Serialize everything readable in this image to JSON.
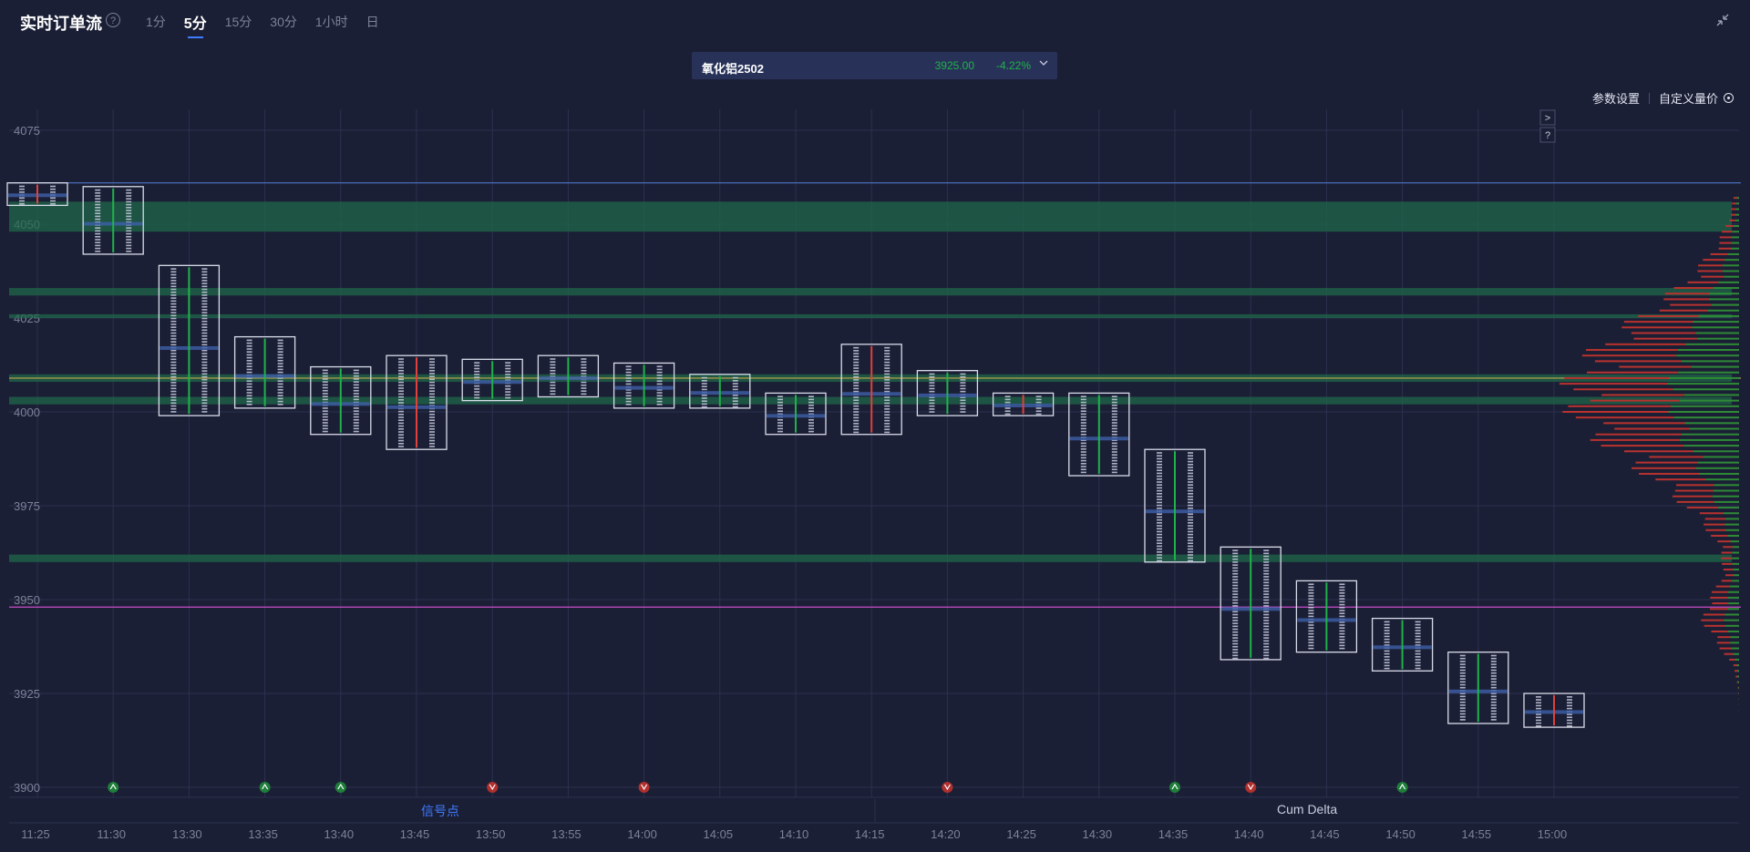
{
  "header": {
    "title": "实时订单流",
    "tabs": [
      {
        "label": "1分",
        "active": false
      },
      {
        "label": "5分",
        "active": true
      },
      {
        "label": "15分",
        "active": false
      },
      {
        "label": "30分",
        "active": false
      },
      {
        "label": "1小时",
        "active": false
      },
      {
        "label": "日",
        "active": false
      }
    ]
  },
  "symbol": {
    "name": "氧化铝2502",
    "price": "3925.00",
    "change": "-4.22%"
  },
  "toolbar": {
    "settings_label": "参数设置",
    "custom_label": "自定义量价"
  },
  "footer": {
    "signal_label": "信号点",
    "cum_delta_label": "Cum Delta"
  },
  "colors": {
    "bg": "#1b1f35",
    "up": "#20b24a",
    "down": "#e0413a",
    "accent": "#3d7bff",
    "box": "#d9dcea"
  },
  "chart_data": {
    "type": "footprint",
    "ylim": [
      3895,
      4080
    ],
    "yticks": [
      4075,
      4050,
      4025,
      4000,
      3975,
      3950,
      3925,
      3900
    ],
    "categories": [
      "11:25",
      "11:30",
      "13:30",
      "13:35",
      "13:40",
      "13:45",
      "13:50",
      "13:55",
      "14:00",
      "14:05",
      "14:10",
      "14:15",
      "14:20",
      "14:25",
      "14:30",
      "14:35",
      "14:40",
      "14:45",
      "14:50",
      "14:55",
      "15:00"
    ],
    "bars": [
      {
        "time": "11:25",
        "high": 4061,
        "low": 4055,
        "delta": "down"
      },
      {
        "time": "11:30",
        "high": 4060,
        "low": 4042,
        "delta": "up"
      },
      {
        "time": "13:30",
        "high": 4039,
        "low": 3999,
        "delta": "up"
      },
      {
        "time": "13:35",
        "high": 4020,
        "low": 4001,
        "delta": "up"
      },
      {
        "time": "13:40",
        "high": 4012,
        "low": 3994,
        "delta": "up"
      },
      {
        "time": "13:45",
        "high": 4015,
        "low": 3990,
        "delta": "down"
      },
      {
        "time": "13:50",
        "high": 4014,
        "low": 4003,
        "delta": "up"
      },
      {
        "time": "13:55",
        "high": 4015,
        "low": 4004,
        "delta": "up"
      },
      {
        "time": "14:00",
        "high": 4013,
        "low": 4001,
        "delta": "up"
      },
      {
        "time": "14:05",
        "high": 4010,
        "low": 4001,
        "delta": "up"
      },
      {
        "time": "14:10",
        "high": 4005,
        "low": 3994,
        "delta": "up"
      },
      {
        "time": "14:15",
        "high": 4018,
        "low": 3994,
        "delta": "down"
      },
      {
        "time": "14:20",
        "high": 4011,
        "low": 3999,
        "delta": "up"
      },
      {
        "time": "14:25",
        "high": 4005,
        "low": 3999,
        "delta": "down"
      },
      {
        "time": "14:30",
        "high": 4005,
        "low": 3983,
        "delta": "up"
      },
      {
        "time": "14:35",
        "high": 3990,
        "low": 3960,
        "delta": "up"
      },
      {
        "time": "14:40",
        "high": 3964,
        "low": 3934,
        "delta": "up"
      },
      {
        "time": "14:45",
        "high": 3955,
        "low": 3936,
        "delta": "up"
      },
      {
        "time": "14:50",
        "high": 3945,
        "low": 3931,
        "delta": "up"
      },
      {
        "time": "14:55",
        "high": 3936,
        "low": 3917,
        "delta": "up"
      },
      {
        "time": "15:00",
        "high": 3925,
        "low": 3916,
        "delta": "down"
      }
    ],
    "bands": [
      {
        "from": 4048,
        "to": 4056
      },
      {
        "from": 4031,
        "to": 4033
      },
      {
        "from": 4025,
        "to": 4026
      },
      {
        "from": 4008,
        "to": 4010
      },
      {
        "from": 4002,
        "to": 4004
      },
      {
        "from": 3960,
        "to": 3962
      }
    ],
    "hlines": [
      {
        "value": 4061,
        "color": "#4d76c7"
      },
      {
        "value": 4009,
        "color": "#c6a84a"
      },
      {
        "value": 3948,
        "color": "#c94ec9"
      }
    ],
    "signals": [
      {
        "time": "11:30",
        "type": "up"
      },
      {
        "time": "13:35",
        "type": "up"
      },
      {
        "time": "13:40",
        "type": "up"
      },
      {
        "time": "13:50",
        "type": "down"
      },
      {
        "time": "14:00",
        "type": "down"
      },
      {
        "time": "14:20",
        "type": "down"
      },
      {
        "time": "14:35",
        "type": "up"
      },
      {
        "time": "14:40",
        "type": "down"
      },
      {
        "time": "14:50",
        "type": "up"
      }
    ]
  }
}
